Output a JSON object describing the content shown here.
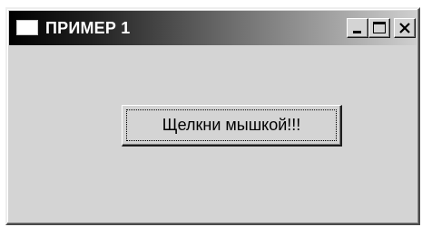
{
  "window": {
    "title": "ПРИМЕР 1",
    "icon": "window-app-icon",
    "controls": {
      "minimize_icon": "minimize-icon",
      "maximize_icon": "maximize-icon",
      "close_icon": "close-icon"
    },
    "colors": {
      "title_gradient_start": "#000000",
      "title_gradient_end": "#cfcfcf",
      "face": "#d4d4d4",
      "title_text": "#ffffff"
    }
  },
  "content": {
    "button_label": "Щелкни мышкой!!!"
  }
}
